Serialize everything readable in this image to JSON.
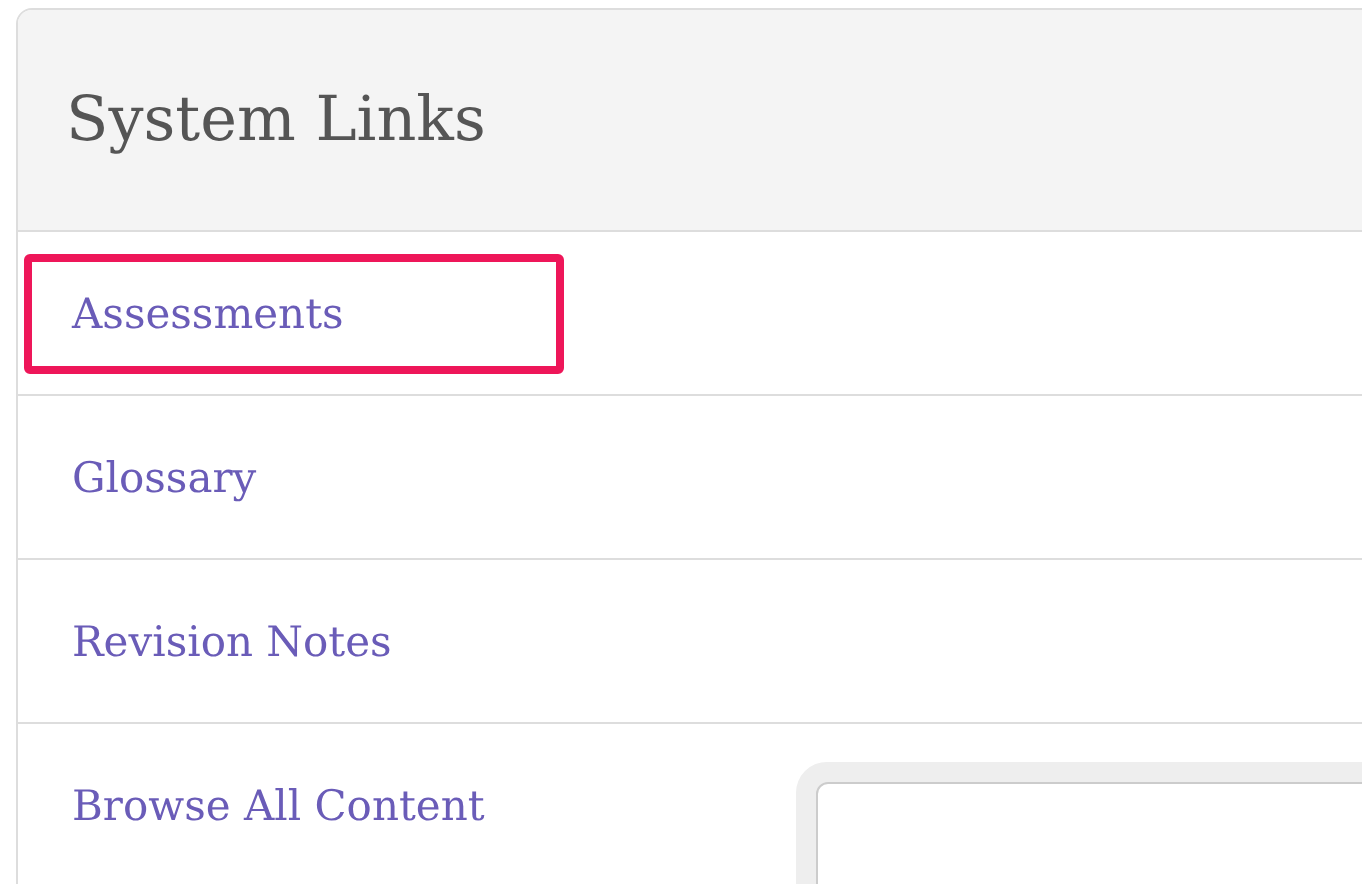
{
  "panel": {
    "title": "System Links",
    "links": [
      {
        "label": "Assessments",
        "highlighted": true
      },
      {
        "label": "Glossary",
        "highlighted": false
      },
      {
        "label": "Revision Notes",
        "highlighted": false
      },
      {
        "label": "Browse All Content",
        "highlighted": false
      }
    ]
  }
}
